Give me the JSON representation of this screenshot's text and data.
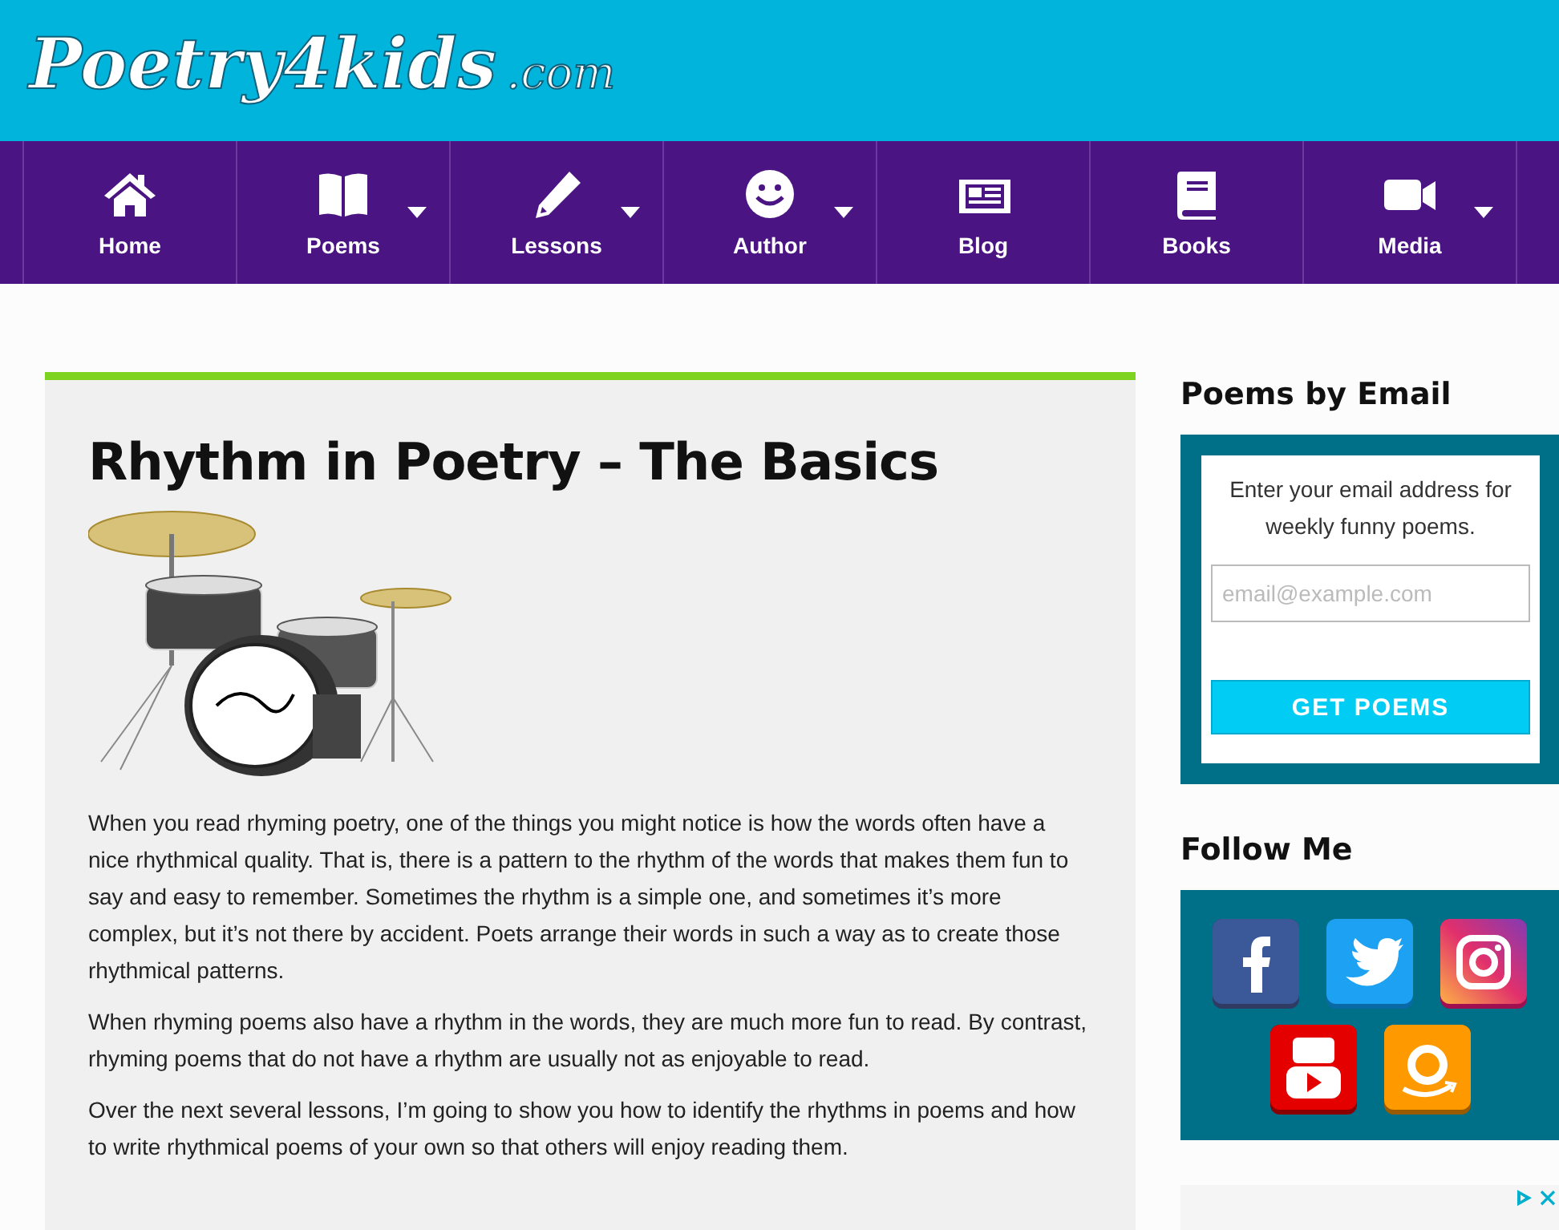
{
  "header": {
    "logo": "Poetry4kids",
    "logo_suffix": ".com"
  },
  "nav": [
    {
      "label": "Home",
      "dropdown": false
    },
    {
      "label": "Poems",
      "dropdown": true
    },
    {
      "label": "Lessons",
      "dropdown": true
    },
    {
      "label": "Author",
      "dropdown": true
    },
    {
      "label": "Blog",
      "dropdown": false
    },
    {
      "label": "Books",
      "dropdown": false
    },
    {
      "label": "Media",
      "dropdown": true
    }
  ],
  "article": {
    "title": "Rhythm in Poetry – The Basics",
    "paragraphs": [
      "When you read rhyming poetry, one of the things you might notice is how the words often have a nice rhythmical quality. That is, there is a pattern to the rhythm of the words that makes them fun to say and easy to remember. Sometimes the rhythm is a simple one, and sometimes it’s more complex, but it’s not there by accident. Poets arrange their words in such a way as to create those rhythmical patterns.",
      "When rhyming poems also have a rhythm in the words, they are much more fun to read. By contrast, rhyming poems that do not have a rhythm are usually not as enjoyable to read.",
      "Over the next several lessons, I’m going to show you how to identify the rhythms in poems and how to write rhythmical poems of your own so that others will enjoy reading them."
    ]
  },
  "sidebar": {
    "email": {
      "heading": "Poems by Email",
      "text": "Enter your email address for weekly funny poems.",
      "placeholder": "email@example.com",
      "button": "GET POEMS"
    },
    "follow": {
      "heading": "Follow Me"
    }
  }
}
